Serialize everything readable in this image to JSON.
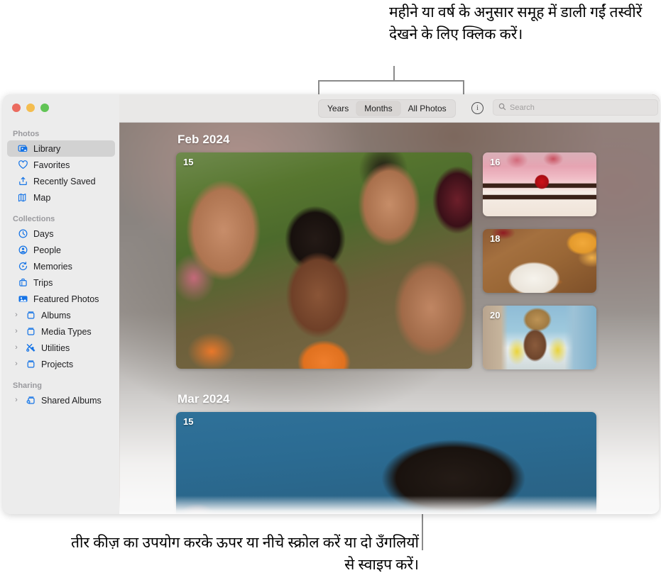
{
  "callouts": {
    "top": "महीने या वर्ष के अनुसार समूह में डाली गईं तस्वीरें देखने के लिए क्लिक करें।",
    "bottom": "तीर कीज़ का उपयोग करके ऊपर या नीचे स्क्रोल करें या दो उँगलियों से स्वाइप करें।"
  },
  "window": {
    "traffic_lights": {
      "close_color": "#eb6b5f",
      "minimize_color": "#f4bd4f",
      "zoom_color": "#61c455"
    }
  },
  "sidebar": {
    "sections": [
      {
        "label": "Photos",
        "items": [
          {
            "label": "Library",
            "icon": "photo-library-icon",
            "selected": true,
            "disclosure": false
          },
          {
            "label": "Favorites",
            "icon": "heart-icon",
            "selected": false,
            "disclosure": false
          },
          {
            "label": "Recently Saved",
            "icon": "tray-arrow-up-icon",
            "selected": false,
            "disclosure": false
          },
          {
            "label": "Map",
            "icon": "map-icon",
            "selected": false,
            "disclosure": false
          }
        ]
      },
      {
        "label": "Collections",
        "items": [
          {
            "label": "Days",
            "icon": "clock-icon",
            "selected": false,
            "disclosure": false
          },
          {
            "label": "People",
            "icon": "person-circle-icon",
            "selected": false,
            "disclosure": false
          },
          {
            "label": "Memories",
            "icon": "memories-play-icon",
            "selected": false,
            "disclosure": false
          },
          {
            "label": "Trips",
            "icon": "suitcase-icon",
            "selected": false,
            "disclosure": false
          },
          {
            "label": "Featured Photos",
            "icon": "featured-photo-icon",
            "selected": false,
            "disclosure": false
          },
          {
            "label": "Albums",
            "icon": "album-folder-icon",
            "selected": false,
            "disclosure": true
          },
          {
            "label": "Media Types",
            "icon": "album-folder-icon",
            "selected": false,
            "disclosure": true
          },
          {
            "label": "Utilities",
            "icon": "tools-icon",
            "selected": false,
            "disclosure": true
          },
          {
            "label": "Projects",
            "icon": "album-folder-icon",
            "selected": false,
            "disclosure": true
          }
        ]
      },
      {
        "label": "Sharing",
        "items": [
          {
            "label": "Shared Albums",
            "icon": "shared-album-icon",
            "selected": false,
            "disclosure": true
          }
        ]
      }
    ],
    "disclosure_glyph": "›"
  },
  "toolbar": {
    "segments": [
      {
        "label": "Years",
        "active": false
      },
      {
        "label": "Months",
        "active": true
      },
      {
        "label": "All Photos",
        "active": false
      }
    ],
    "info_icon": "info-circle-icon",
    "info_glyph": "i",
    "search": {
      "placeholder": "Search",
      "value": "",
      "icon": "search-icon"
    }
  },
  "grid": {
    "months": [
      {
        "title": "Feb 2024",
        "photos": [
          {
            "day": "15",
            "art": "art-selfie",
            "name": "photo-feb-15-group-selfie"
          },
          {
            "day": "16",
            "art": "art-cake",
            "name": "photo-feb-16-cake"
          },
          {
            "day": "18",
            "art": "art-food",
            "name": "photo-feb-18-plated-food"
          },
          {
            "day": "20",
            "art": "art-beach",
            "name": "photo-feb-20-beach-portrait"
          }
        ]
      },
      {
        "title": "Mar 2024",
        "photos": [
          {
            "day": "15",
            "art": "art-blue",
            "name": "photo-mar-15-blue-portrait"
          }
        ]
      }
    ]
  }
}
